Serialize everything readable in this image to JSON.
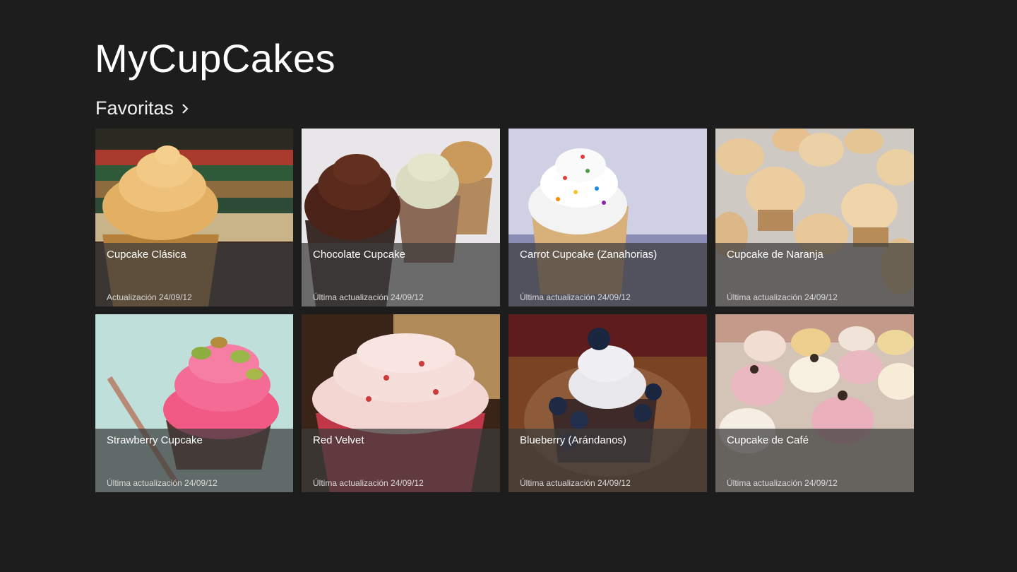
{
  "app": {
    "title": "MyCupCakes"
  },
  "section": {
    "title": "Favoritas"
  },
  "items": [
    {
      "name": "Cupcake Clásica",
      "updated": "Actualización 24/09/12",
      "icon": "cupcake-photo",
      "selected": true
    },
    {
      "name": "Chocolate Cupcake",
      "updated": "Última actualización 24/09/12",
      "icon": "cupcake-photo"
    },
    {
      "name": "Carrot Cupcake (Zanahorias)",
      "updated": "Última actualización 24/09/12",
      "icon": "cupcake-photo"
    },
    {
      "name": "Cupcake de Naranja",
      "updated": "Última actualización 24/09/12",
      "icon": "cupcake-photo"
    },
    {
      "name": "Strawberry Cupcake",
      "updated": "Última actualización 24/09/12",
      "icon": "cupcake-photo",
      "selected": true
    },
    {
      "name": "Red Velvet",
      "updated": "Última actualización 24/09/12",
      "icon": "cupcake-photo"
    },
    {
      "name": "Blueberry (Arándanos)",
      "updated": "Última actualización 24/09/12",
      "icon": "cupcake-photo"
    },
    {
      "name": "Cupcake de Café",
      "updated": "Última actualización 24/09/12",
      "icon": "cupcake-photo"
    }
  ],
  "colors": {
    "background": "#1d1d1d",
    "caption_overlay": "rgba(60,60,60,0.72)",
    "text": "#ffffff",
    "selection_border": "#dcdcdc"
  }
}
